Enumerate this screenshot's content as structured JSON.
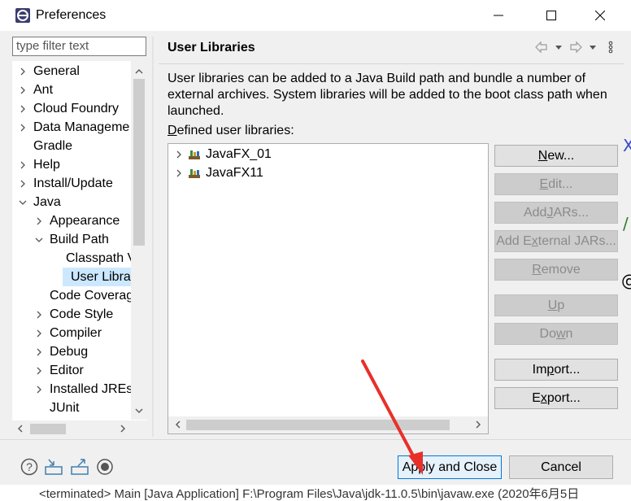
{
  "window": {
    "title": "Preferences",
    "controls": {
      "minimize": "minimize-icon",
      "maximize": "maximize-icon",
      "close": "close-icon"
    }
  },
  "filter": {
    "placeholder": "type filter text"
  },
  "tree": {
    "items": [
      {
        "label": "General",
        "level": 0,
        "expander": "right"
      },
      {
        "label": "Ant",
        "level": 0,
        "expander": "right"
      },
      {
        "label": "Cloud Foundry",
        "level": 0,
        "expander": "right"
      },
      {
        "label": "Data Manageme",
        "level": 0,
        "expander": "right"
      },
      {
        "label": "Gradle",
        "level": 0,
        "expander": "none"
      },
      {
        "label": "Help",
        "level": 0,
        "expander": "right"
      },
      {
        "label": "Install/Update",
        "level": 0,
        "expander": "right"
      },
      {
        "label": "Java",
        "level": 0,
        "expander": "down"
      },
      {
        "label": "Appearance",
        "level": 1,
        "expander": "right"
      },
      {
        "label": "Build Path",
        "level": 1,
        "expander": "down"
      },
      {
        "label": "Classpath V",
        "level": 2,
        "expander": "none"
      },
      {
        "label": "User Librar",
        "level": 2,
        "expander": "none",
        "selected": true
      },
      {
        "label": "Code Coverag",
        "level": 1,
        "expander": "none"
      },
      {
        "label": "Code Style",
        "level": 1,
        "expander": "right"
      },
      {
        "label": "Compiler",
        "level": 1,
        "expander": "right"
      },
      {
        "label": "Debug",
        "level": 1,
        "expander": "right"
      },
      {
        "label": "Editor",
        "level": 1,
        "expander": "right"
      },
      {
        "label": "Installed JREs",
        "level": 1,
        "expander": "right"
      },
      {
        "label": "JUnit",
        "level": 1,
        "expander": "none"
      }
    ]
  },
  "page": {
    "title": "User Libraries",
    "description": "User libraries can be added to a Java Build path and bundle a number of external archives. System libraries will be added to the boot class path when launched.",
    "defined_label_mnemonic": "D",
    "defined_label_rest": "efined user libraries:",
    "libraries": [
      "JavaFX_01",
      "JavaFX11"
    ]
  },
  "buttons": [
    {
      "pre": "",
      "m": "N",
      "post": "ew...",
      "enabled": true
    },
    {
      "pre": "",
      "m": "E",
      "post": "dit...",
      "enabled": false
    },
    {
      "pre": "Add ",
      "m": "J",
      "post": "ARs...",
      "enabled": false
    },
    {
      "pre": "Add E",
      "m": "x",
      "post": "ternal JARs...",
      "enabled": false
    },
    {
      "pre": "",
      "m": "R",
      "post": "emove",
      "enabled": false
    },
    {
      "pre": "",
      "m": "U",
      "post": "p",
      "enabled": false
    },
    {
      "pre": "Do",
      "m": "w",
      "post": "n",
      "enabled": false
    },
    {
      "pre": "Im",
      "m": "p",
      "post": "ort...",
      "enabled": true
    },
    {
      "pre": "E",
      "m": "x",
      "post": "port...",
      "enabled": true
    }
  ],
  "footer": {
    "apply_close": "Apply and Close",
    "cancel": "Cancel",
    "icons": [
      "help-icon",
      "import-preferences-icon",
      "export-preferences-icon",
      "record-icon"
    ]
  },
  "background_console": "<terminated> Main [Java Application] F:\\Program Files\\Java\\jdk-11.0.5\\bin\\javaw.exe (2020年6月5日",
  "colors": {
    "selection": "#cce8ff",
    "annotation_arrow": "#e8302a"
  }
}
